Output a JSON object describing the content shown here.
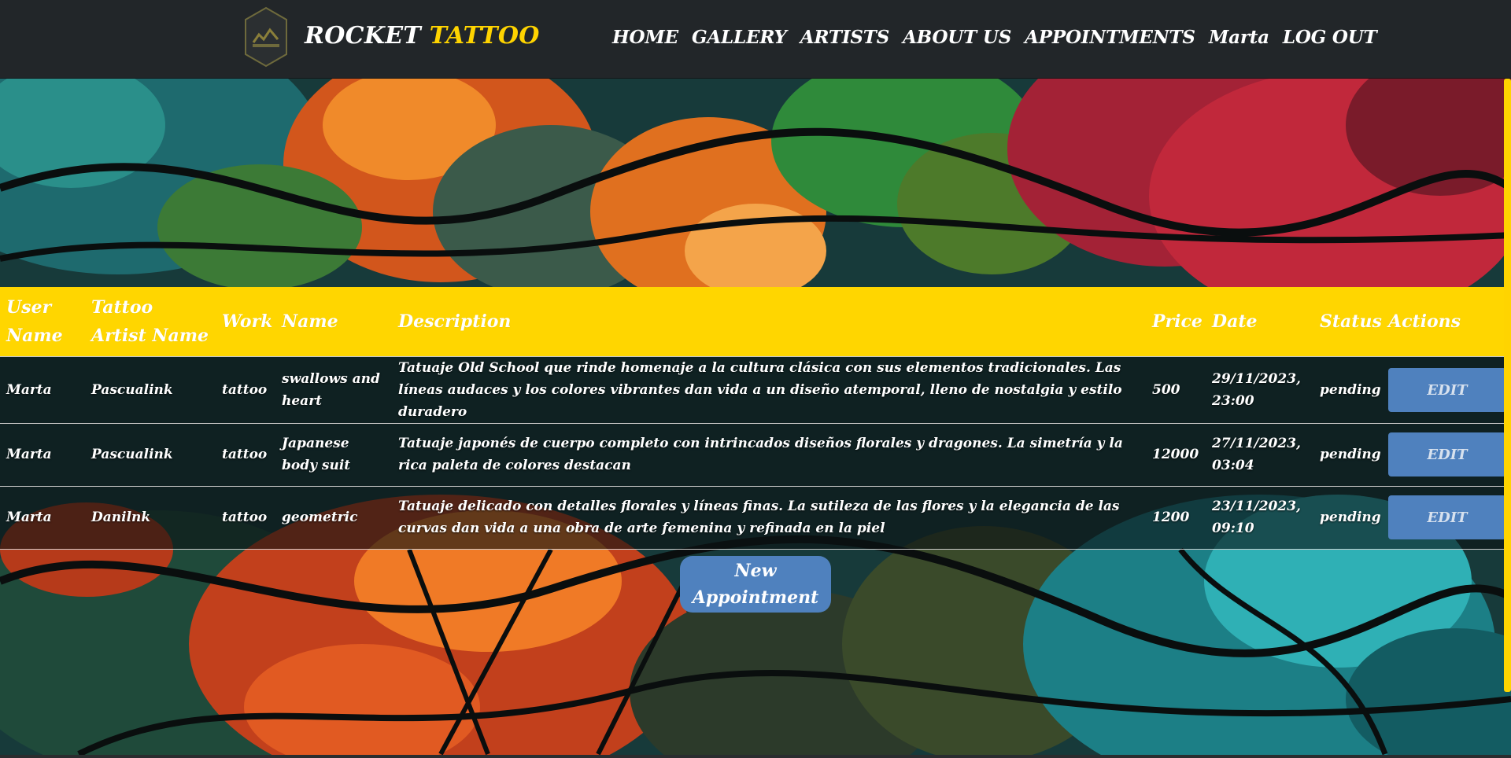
{
  "brand": {
    "part1": "ROCKET",
    "part2": "TATTOO",
    "logo_icon": "rocket-tattoo-logo-icon"
  },
  "nav": {
    "items": [
      {
        "label": "HOME"
      },
      {
        "label": "GALLERY"
      },
      {
        "label": "ARTISTS"
      },
      {
        "label": "ABOUT US"
      },
      {
        "label": "APPOINTMENTS"
      },
      {
        "label": "Marta"
      },
      {
        "label": "LOG OUT"
      }
    ]
  },
  "table": {
    "headers": {
      "user_name": "User Name",
      "artist_name": "Tattoo Artist Name",
      "work": "Work",
      "name": "Name",
      "description": "Description",
      "price": "Price",
      "date": "Date",
      "status": "Status",
      "actions": "Actions"
    },
    "rows": [
      {
        "user": "Marta",
        "artist": "Pascualink",
        "work": "tattoo",
        "name": "swallows and heart",
        "description": "Tatuaje Old School que rinde homenaje a la cultura clásica con sus elementos tradicionales. Las líneas audaces y los colores vibrantes dan vida a un diseño atemporal, lleno de nostalgia y estilo duradero",
        "price": "500",
        "date": "29/11/2023, 23:00",
        "status": "pending",
        "action": "EDIT"
      },
      {
        "user": "Marta",
        "artist": "Pascualink",
        "work": "tattoo",
        "name": "Japanese body suit",
        "description": "Tatuaje japonés de cuerpo completo con intrincados diseños florales y dragones. La simetría y la rica paleta de colores destacan",
        "price": "12000",
        "date": "27/11/2023, 03:04",
        "status": "pending",
        "action": "EDIT"
      },
      {
        "user": "Marta",
        "artist": "Danilnk",
        "work": "tattoo",
        "name": "geometric",
        "description": "Tatuaje delicado con detalles florales y líneas finas. La sutileza de las flores y la elegancia de las curvas dan vida a una obra de arte femenina y refinada en la piel",
        "price": "1200",
        "date": "23/11/2023, 09:10",
        "status": "pending",
        "action": "EDIT"
      }
    ]
  },
  "new_appointment_label": "New Appointment",
  "colors": {
    "header_bg": "#222629",
    "accent_yellow": "#ffd400",
    "button_blue": "#4f81be"
  }
}
